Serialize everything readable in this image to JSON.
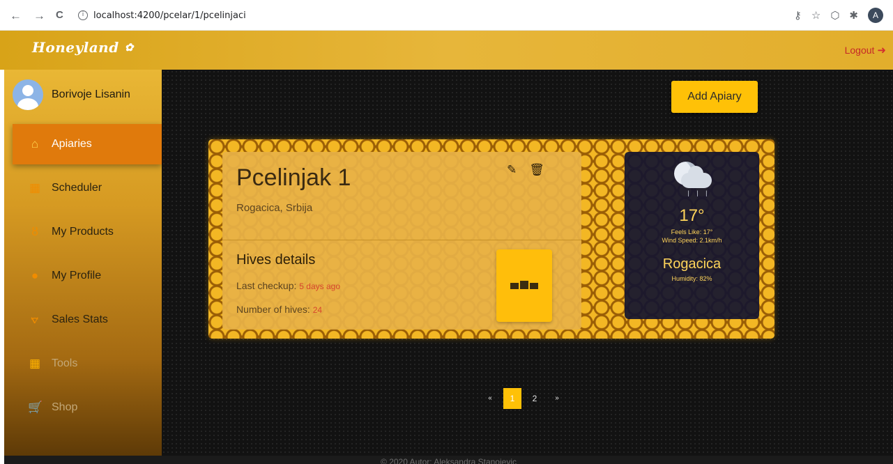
{
  "browser": {
    "back": "←",
    "forward": "→",
    "reload": "C",
    "info": "i",
    "url": "localhost:4200/pcelar/1/pcelinjaci",
    "profile_initial": "A"
  },
  "header": {
    "brand": "Honeyland",
    "logout_label": "Logout"
  },
  "sidebar": {
    "user_name": "Borivoje Lisanin",
    "items": [
      {
        "label": "Apiaries",
        "icon": "apiary-icon",
        "glyph": "⌂"
      },
      {
        "label": "Scheduler",
        "icon": "calendar-icon",
        "glyph": "▦"
      },
      {
        "label": "My Products",
        "icon": "products-icon",
        "glyph": "ȣ"
      },
      {
        "label": "My Profile",
        "icon": "person-icon",
        "glyph": "●"
      },
      {
        "label": "Sales Stats",
        "icon": "chart-icon",
        "glyph": "⦡"
      },
      {
        "label": "Tools",
        "icon": "calculator-icon",
        "glyph": "▦"
      },
      {
        "label": "Shop",
        "icon": "cart-icon",
        "glyph": "🛒"
      }
    ]
  },
  "main": {
    "add_button": "Add Apiary",
    "card": {
      "name": "Pcelinjak 1",
      "location": "Rogacica, Srbija",
      "hives_title": "Hives details",
      "last_checkup_label": "Last checkup: ",
      "last_checkup_value": "5 days ago",
      "hives_count_label": "Number of hives: ",
      "hives_count_value": "24",
      "edit_glyph": "✎",
      "delete_glyph": "🗑"
    },
    "weather": {
      "temperature": "17°",
      "feels_like": "Feels Like: 17°",
      "wind_speed": "Wind Speed: 2.1km/h",
      "city": "Rogacica",
      "humidity": "Humidity: 82%"
    },
    "pagination": {
      "prev": "«",
      "pages": [
        "1",
        "2"
      ],
      "next": "»",
      "current": "1"
    }
  },
  "footer": {
    "text": "© 2020 Autor: Aleksandra Stanojevic"
  }
}
